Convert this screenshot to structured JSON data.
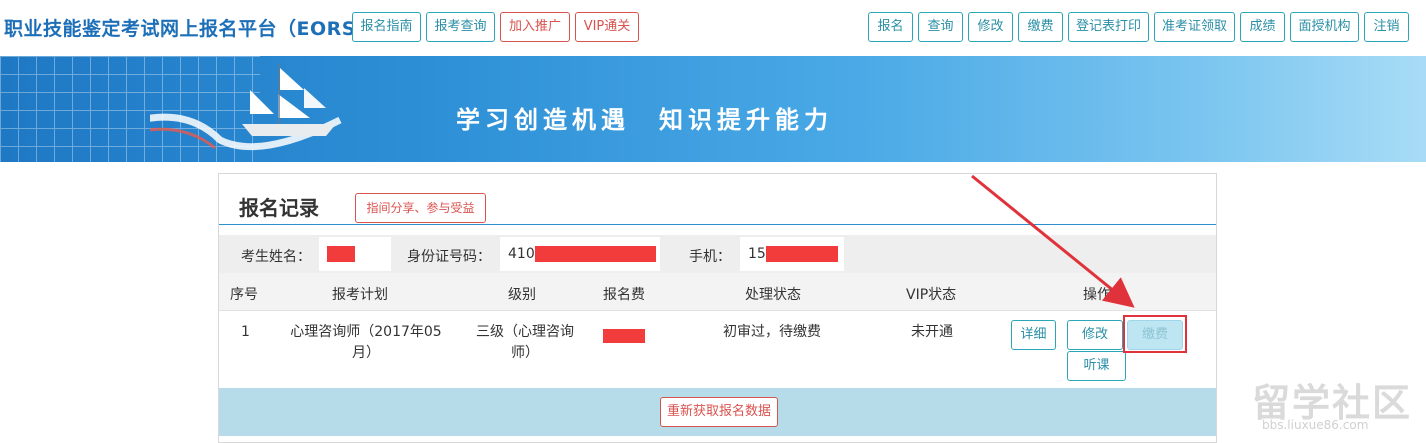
{
  "site_title": "职业技能鉴定考试网上报名平台（EORS）",
  "nav_left": [
    {
      "label": "报名指南",
      "style": "teal"
    },
    {
      "label": "报考查询",
      "style": "teal"
    },
    {
      "label": "加入推广",
      "style": "red"
    },
    {
      "label": "VIP通关",
      "style": "red"
    }
  ],
  "nav_right": [
    {
      "label": "报名"
    },
    {
      "label": "查询"
    },
    {
      "label": "修改"
    },
    {
      "label": "缴费"
    },
    {
      "label": "登记表打印"
    },
    {
      "label": "准考证领取"
    },
    {
      "label": "成绩"
    },
    {
      "label": "面授机构"
    },
    {
      "label": "注销"
    }
  ],
  "banner": {
    "slogan": "学习创造机遇　知识提升能力"
  },
  "panel": {
    "title": "报名记录",
    "share_label": "指间分享、参与受益",
    "info": {
      "name_label": "考生姓名：",
      "id_label": "身份证号码：",
      "id_prefix": "410",
      "phone_label": "手机：",
      "phone_prefix": "15"
    },
    "columns": [
      "序号",
      "报考计划",
      "级别",
      "报名费",
      "处理状态",
      "VIP状态",
      "操作"
    ],
    "rows": [
      {
        "index": "1",
        "plan": "心理咨询师（2017年05月）",
        "level": "三级（心理咨询师）",
        "status": "初审过，待缴费",
        "vip": "未开通",
        "actions": {
          "detail": "详细",
          "edit": "修改",
          "pay": "缴费",
          "listen": "听课"
        }
      }
    ],
    "refresh_label": "重新获取报名数据"
  },
  "watermark": {
    "text": "留学社区",
    "url": "bbs.liuxue86.com"
  },
  "colors": {
    "accent": "#2a8fa6",
    "title_blue": "#1d6fb8",
    "red": "#d9534f",
    "redaction": "#f23b3b"
  }
}
